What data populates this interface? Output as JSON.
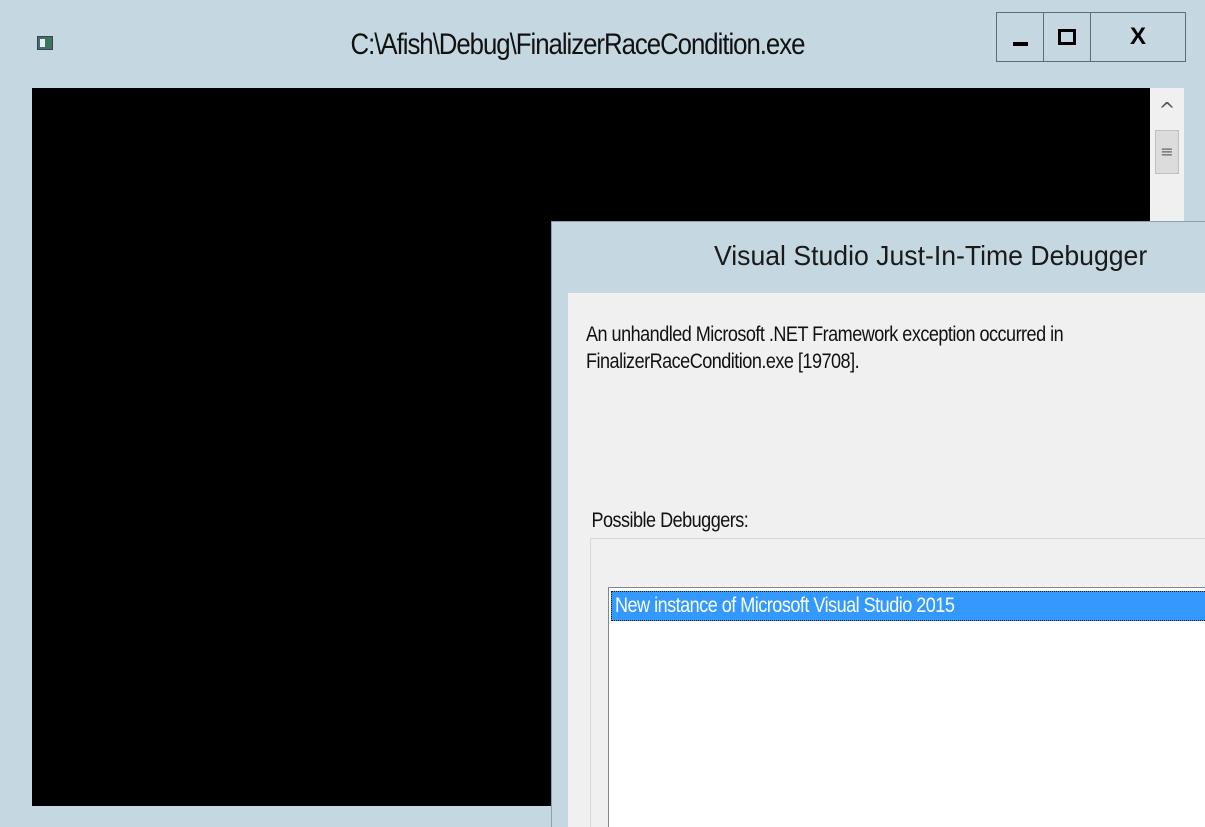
{
  "console_window": {
    "title": "C:\\Afish\\Debug\\FinalizerRaceCondition.exe",
    "app_icon": "console-app-icon",
    "buttons": {
      "minimize_icon": "minimize-icon",
      "maximize_icon": "maximize-icon",
      "close_label": "X"
    },
    "scrollbar": {
      "up_arrow": "^",
      "thumb_grip": "≡"
    },
    "colors": {
      "frame": "#c5d8e1",
      "console_background": "#000000"
    }
  },
  "jit_dialog": {
    "title": "Visual Studio Just-In-Time Debugger",
    "message_line1": "An unhandled Microsoft .NET Framework exception occurred in",
    "message_line2": "FinalizerRaceCondition.exe [19708].",
    "debuggers_label": "Possible Debuggers:",
    "debuggers": [
      {
        "label": "New instance of Microsoft Visual Studio 2015",
        "selected": true
      }
    ],
    "colors": {
      "selection": "#3399ff",
      "body": "#f0f0f0"
    }
  }
}
